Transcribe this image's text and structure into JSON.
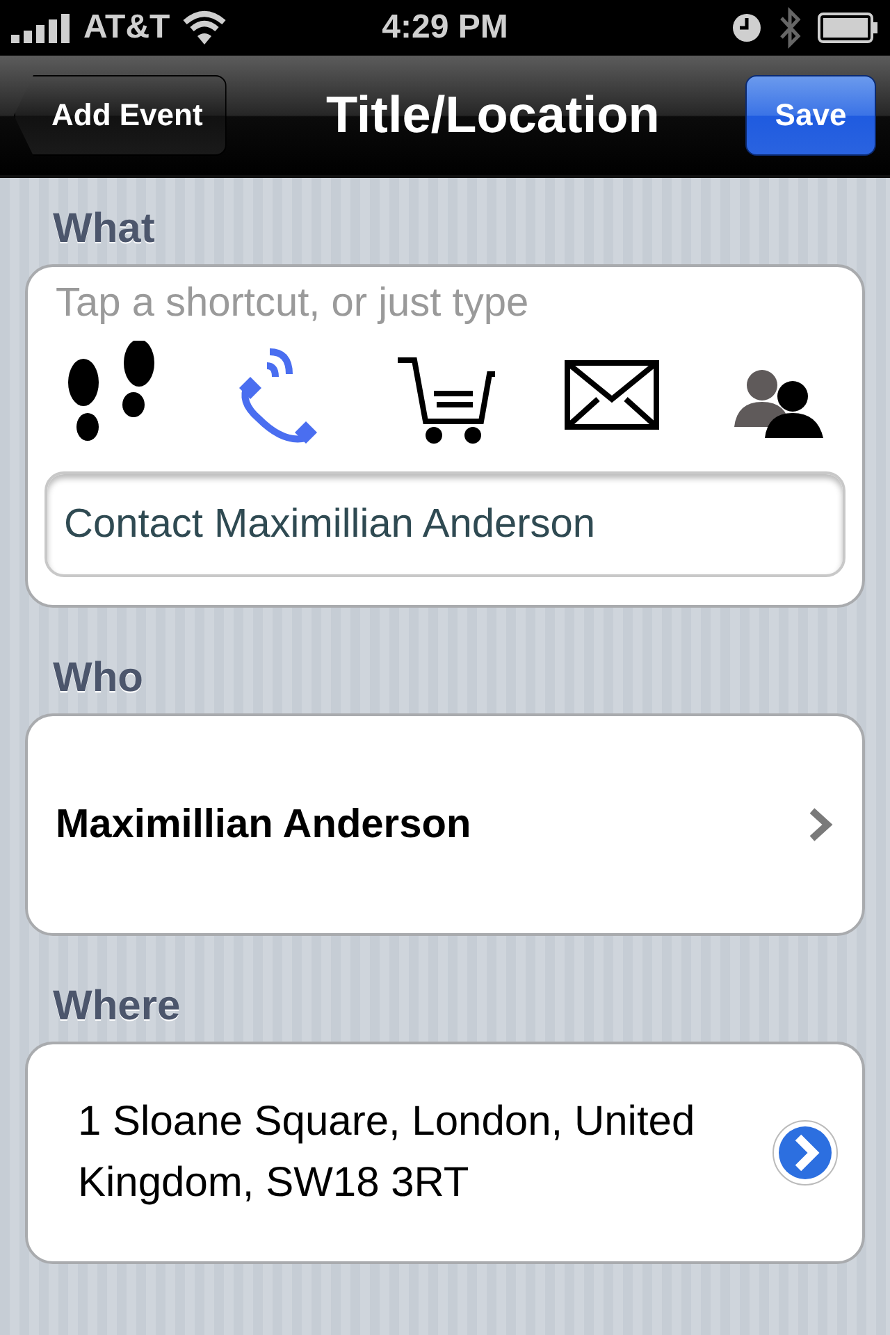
{
  "status_bar": {
    "carrier": "AT&T",
    "time": "4:29 PM"
  },
  "nav_bar": {
    "back_button": "Add Event",
    "title": "Title/Location",
    "save_button": "Save"
  },
  "what": {
    "header": "What",
    "hint": "Tap a shortcut, or just type",
    "shortcuts": [
      {
        "kind": "footsteps",
        "selected": false
      },
      {
        "kind": "phone",
        "selected": true
      },
      {
        "kind": "cart",
        "selected": false
      },
      {
        "kind": "mail",
        "selected": false
      },
      {
        "kind": "people",
        "selected": false
      }
    ],
    "title_field": {
      "value": "Contact Maximillian Anderson"
    }
  },
  "who": {
    "header": "Who",
    "name": "Maximillian Anderson"
  },
  "where": {
    "header": "Where",
    "address": "1 Sloane Square, London, United Kingdom, SW18 3RT"
  }
}
